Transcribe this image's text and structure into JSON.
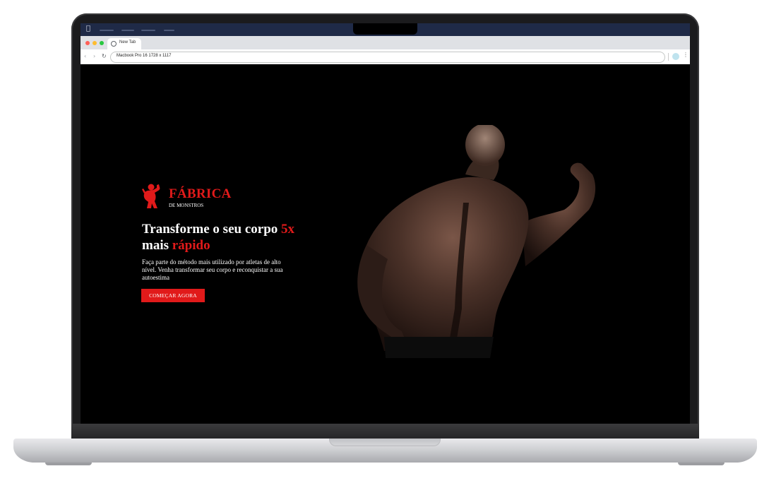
{
  "menubar": {
    "apple_glyph": "",
    "items": [
      "",
      "",
      "",
      ""
    ]
  },
  "browser": {
    "tab_title": "New Tab",
    "address_text": "Macbook Pro 16  1728 x 1117",
    "back_glyph": "‹",
    "forward_glyph": "›",
    "reload_glyph": "↻",
    "menu_glyph": "⋮"
  },
  "site": {
    "brand_name": "FÁBRICA",
    "brand_subtitle": "DE MONSTROS",
    "headline_part1": "Transforme o seu corpo ",
    "headline_highlight1": "5x",
    "headline_part2": "mais ",
    "headline_highlight2": "rápido",
    "subtext": "Faça parte do método mais utilizado por atletas de alto nível. Venha transformar seu corpo e reconquistar a sua autoestima",
    "cta_label": "COMEÇAR AGORA"
  },
  "colors": {
    "accent": "#e11a1a",
    "page_background": "#000000",
    "menubar": "#1f2a47"
  },
  "icons": {
    "brand": "flexing-man-icon",
    "tab": "globe-icon"
  }
}
